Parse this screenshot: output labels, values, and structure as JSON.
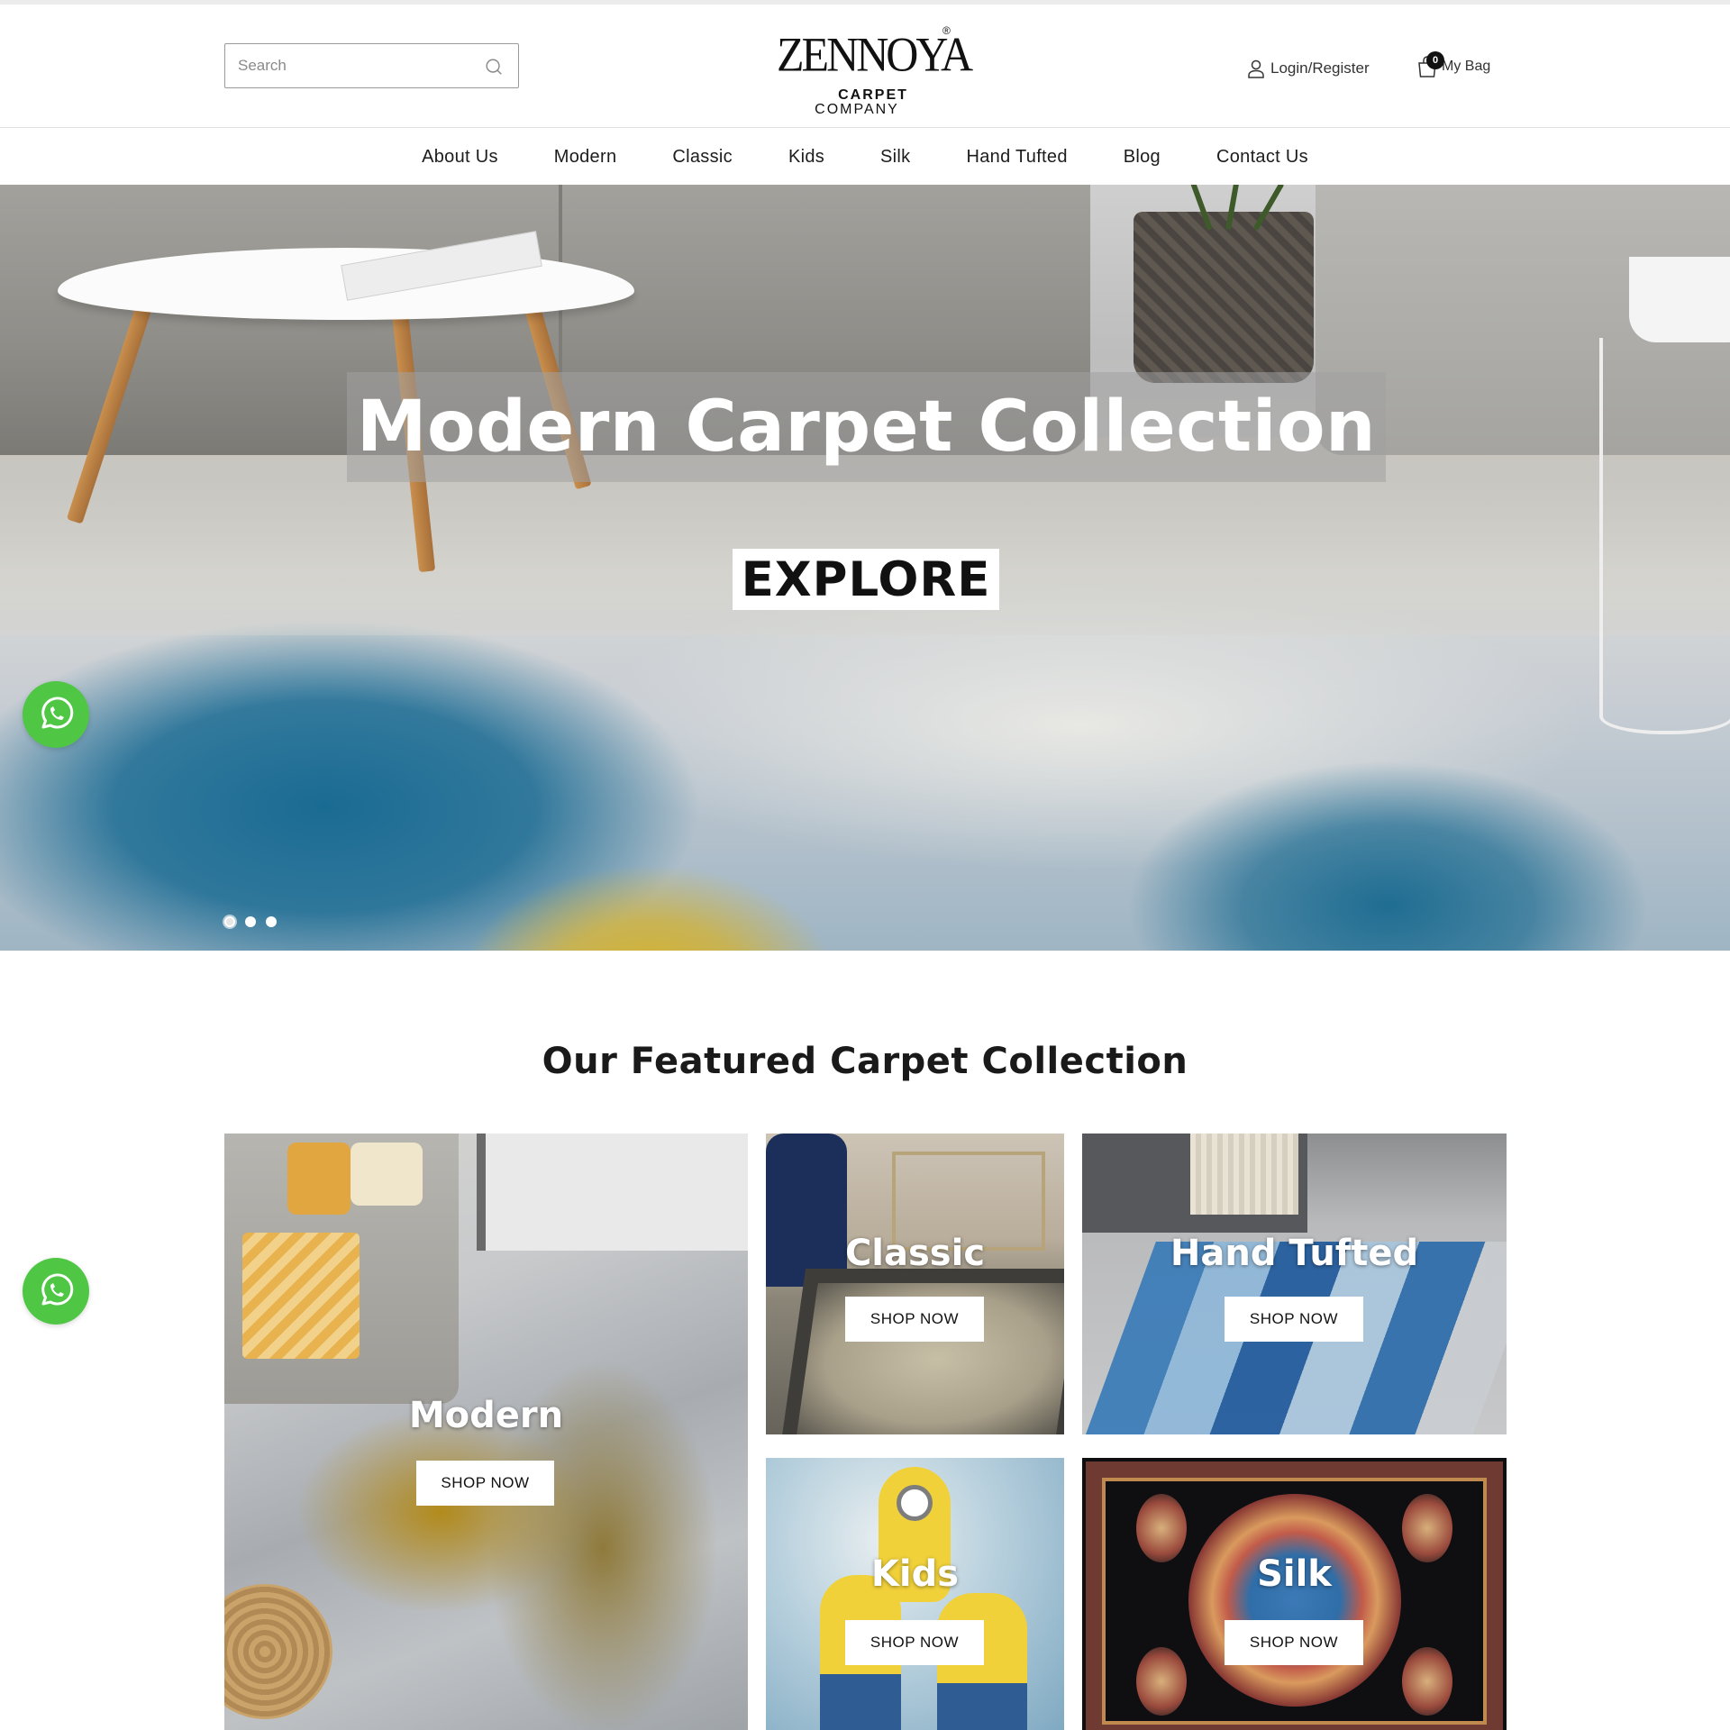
{
  "header": {
    "search_placeholder": "Search",
    "logo_text": "ZENNOYA",
    "logo_registered": "®",
    "logo_line1": "CARPET",
    "logo_line2": "COMPANY",
    "login_label": "Login/Register",
    "bag_label": "My Bag",
    "bag_count": "0"
  },
  "nav": {
    "items": [
      {
        "label": "About Us"
      },
      {
        "label": "Modern"
      },
      {
        "label": "Classic"
      },
      {
        "label": "Kids"
      },
      {
        "label": "Silk"
      },
      {
        "label": "Hand Tufted"
      },
      {
        "label": "Blog"
      },
      {
        "label": "Contact Us"
      }
    ]
  },
  "hero": {
    "title": "Modern Carpet Collection",
    "button_label": "EXPLORE",
    "slide_count": 3,
    "active_slide": 1
  },
  "featured": {
    "title": "Our Featured Carpet Collection",
    "cards": [
      {
        "label": "Modern",
        "button": "SHOP NOW"
      },
      {
        "label": "Classic",
        "button": "SHOP NOW"
      },
      {
        "label": "Hand Tufted",
        "button": "SHOP NOW"
      },
      {
        "label": "Kids",
        "button": "SHOP NOW"
      },
      {
        "label": "Silk",
        "button": "SHOP NOW"
      }
    ]
  },
  "floating": {
    "whatsapp_icon": "whatsapp-icon",
    "whatsapp_color": "#4fc745"
  }
}
